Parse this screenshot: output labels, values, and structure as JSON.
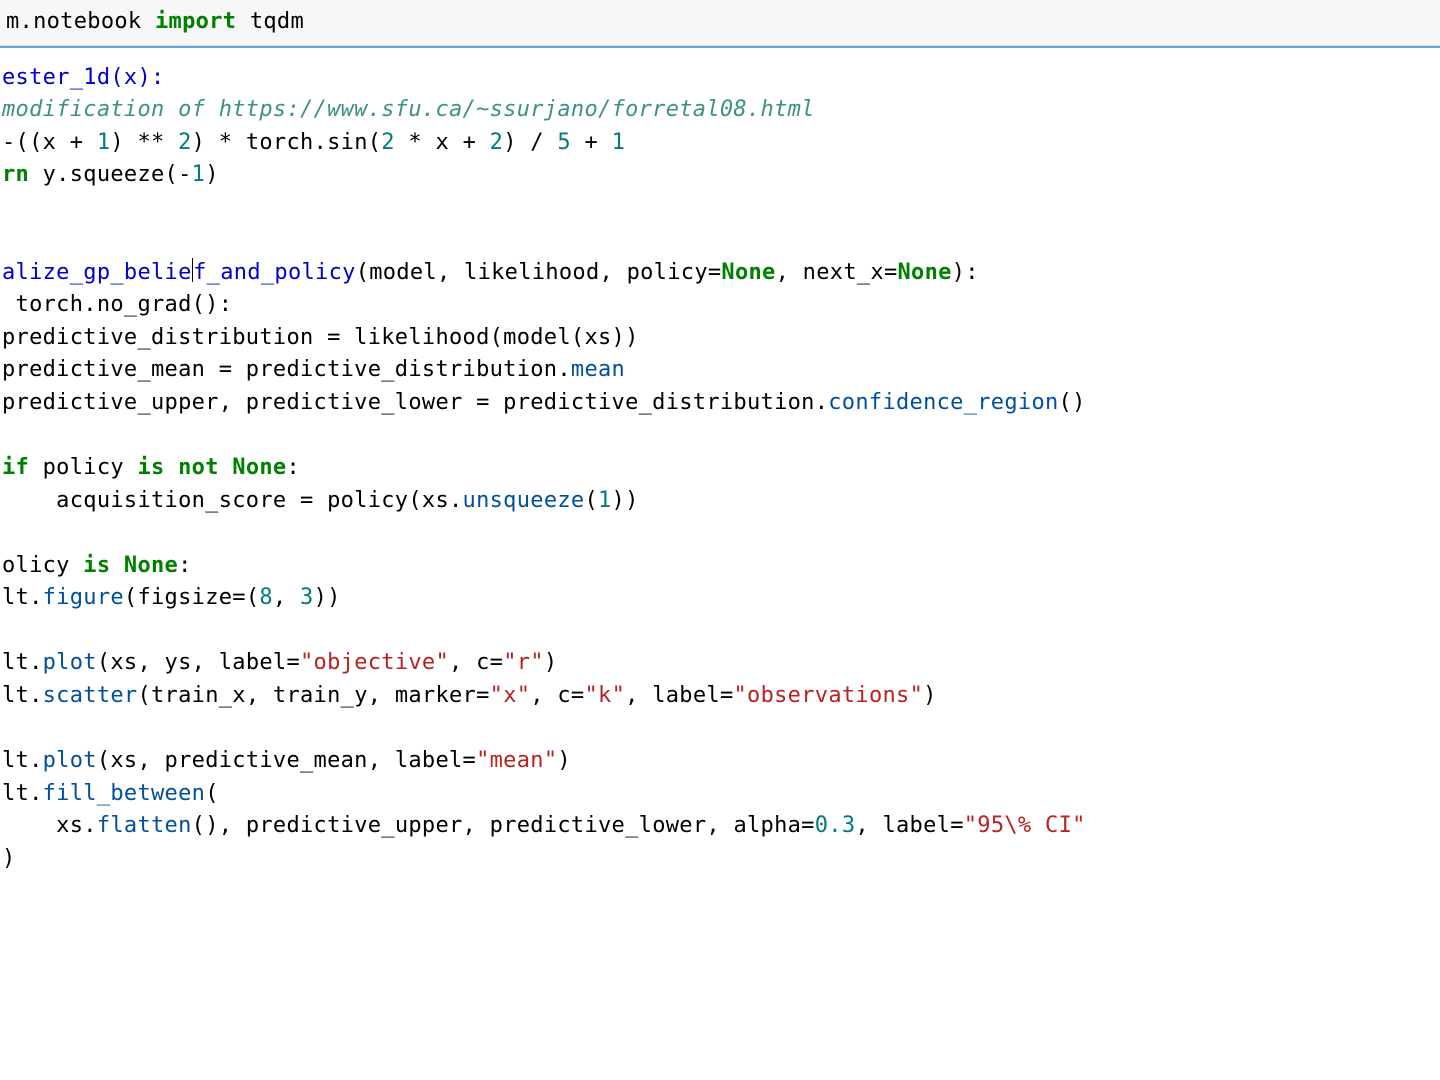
{
  "cell1": {
    "seg_module": "m.notebook ",
    "seg_import": "import",
    "seg_name": " tqdm"
  },
  "cell2": {
    "l1": {
      "a": "ester_1d(x):"
    },
    "l2": {
      "a": "modification of https://www.sfu.ca/~ssurjano/forretal08.html"
    },
    "l3": {
      "a": "-((x + ",
      "n1": "1",
      "b": ") ** ",
      "n2": "2",
      "c": ") * torch.sin(",
      "n3": "2",
      "d": " * x + ",
      "n4": "2",
      "e": ") / ",
      "n5": "5",
      "f": " + ",
      "n6": "1"
    },
    "l4": {
      "a": "rn",
      "b": " y.squeeze(-",
      "n1": "1",
      "c": ")"
    },
    "l5": {
      "a": "alize_gp_belie",
      "b": "f_and_policy",
      "c": "(model, likelihood, policy=",
      "n1": "None",
      "d": ", next_x=",
      "n2": "None",
      "e": "):"
    },
    "l6": {
      "a": " torch.no_grad():"
    },
    "l7": {
      "a": "predictive_distribution = likelihood(model(xs))"
    },
    "l8": {
      "a": "predictive_mean = predictive_distribution.",
      "m": "mean"
    },
    "l9": {
      "a": "predictive_upper, predictive_lower = predictive_distribution.",
      "m": "confidence_region",
      "b": "()"
    },
    "l10": {
      "a": "if",
      "b": " policy ",
      "c": "is not None",
      "d": ":"
    },
    "l11": {
      "a": "    acquisition_score = policy(xs.",
      "m": "unsqueeze",
      "b": "(",
      "n1": "1",
      "c": "))"
    },
    "l12": {
      "a": "olicy ",
      "b": "is None",
      "c": ":"
    },
    "l13": {
      "a": "lt.",
      "m": "figure",
      "b": "(figsize=(",
      "n1": "8",
      "c": ", ",
      "n2": "3",
      "d": "))"
    },
    "l14": {
      "a": "lt.",
      "m": "plot",
      "b": "(xs, ys, label=",
      "s1": "\"objective\"",
      "c": ", c=",
      "s2": "\"r\"",
      "d": ")"
    },
    "l15": {
      "a": "lt.",
      "m": "scatter",
      "b": "(train_x, train_y, marker=",
      "s1": "\"x\"",
      "c": ", c=",
      "s2": "\"k\"",
      "d": ", label=",
      "s3": "\"observations\"",
      "e": ")"
    },
    "l16": {
      "a": "lt.",
      "m": "plot",
      "b": "(xs, predictive_mean, label=",
      "s1": "\"mean\"",
      "c": ")"
    },
    "l17": {
      "a": "lt.",
      "m": "fill_between",
      "b": "("
    },
    "l18": {
      "a": "    xs.",
      "m": "flatten",
      "b": "(), predictive_upper, predictive_lower, alpha=",
      "n1": "0.3",
      "c": ", label=",
      "s1": "\"95\\% CI\""
    },
    "l19": {
      "a": ")"
    }
  }
}
